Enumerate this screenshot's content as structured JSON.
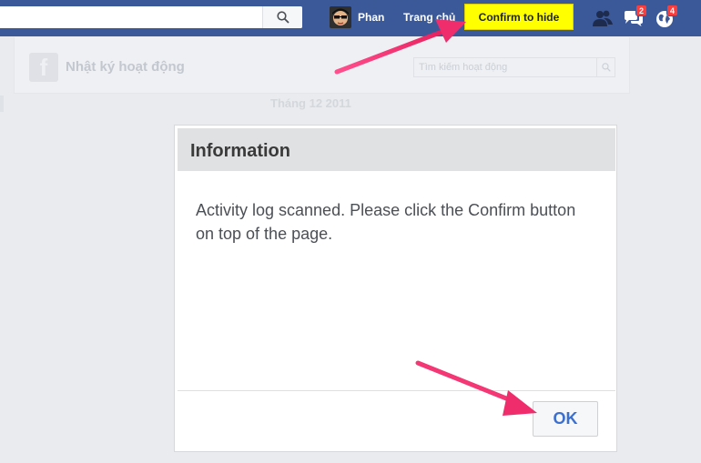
{
  "topbar": {
    "search_placeholder": "",
    "user_name": "Phan",
    "home_label": "Trang chủ",
    "confirm_label": "Confirm to hide",
    "friend_requests_count": "",
    "messages_count": "2",
    "notifications_count": "4"
  },
  "activity_log": {
    "title": "Nhật ký hoạt động",
    "search_placeholder": "Tìm kiếm hoạt động",
    "month": "Tháng 12 2011"
  },
  "dialog": {
    "title": "Information",
    "message": "Activity log scanned. Please click the Confirm button on top of the page.",
    "ok_label": "OK"
  },
  "icons": {
    "search": "search-icon",
    "friends": "friends-icon",
    "messages": "messages-icon",
    "notifications": "globe-icon",
    "logo": "facebook-logo-icon",
    "arrow": "arrow-annotation"
  },
  "colors": {
    "brand_blue": "#3b5998",
    "confirm_yellow": "#ffff00",
    "arrow_pink": "#f0306e",
    "badge_red": "#fa3e3e",
    "ok_text_blue": "#3b6fd0"
  }
}
